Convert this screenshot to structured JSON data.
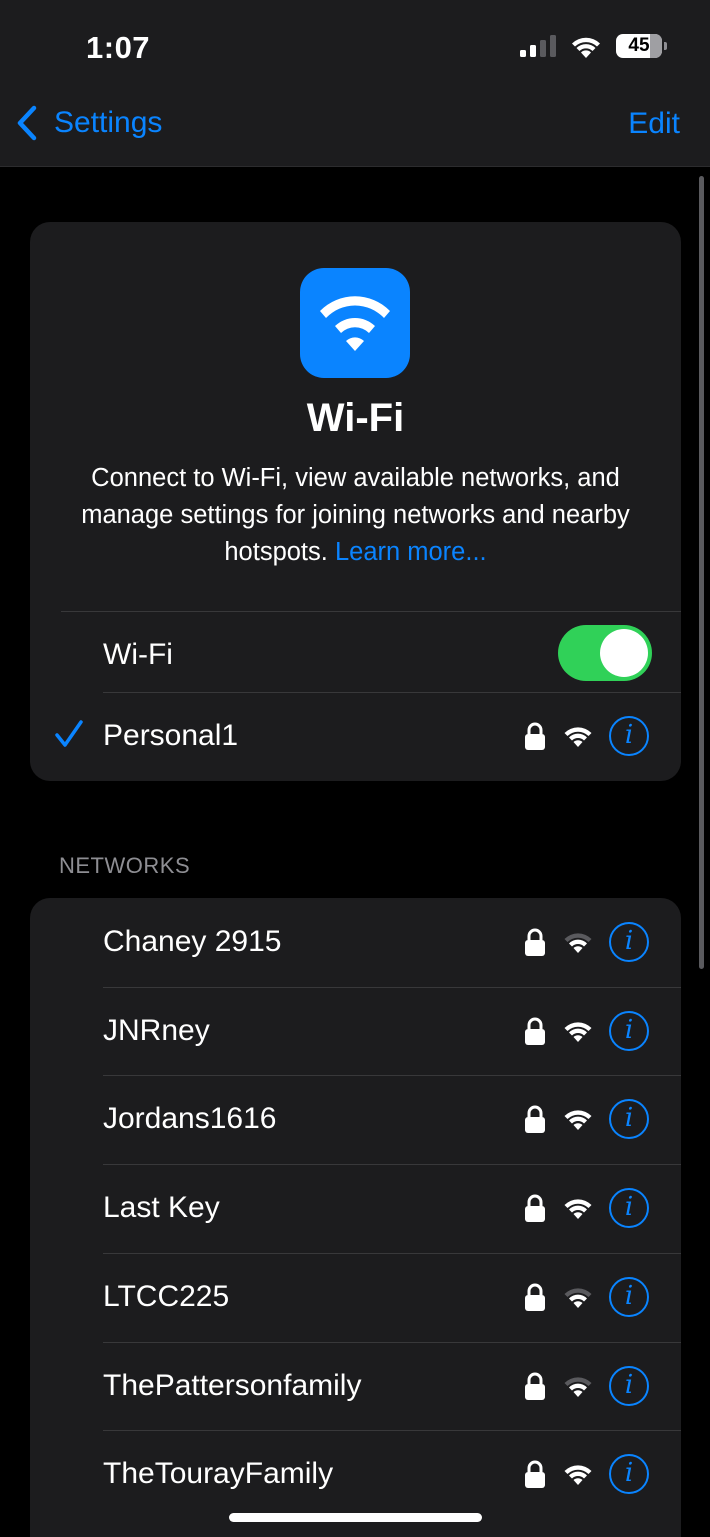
{
  "status_bar": {
    "time": "1:07",
    "battery": "45",
    "cell_signal_icon": "cellular-signal-icon",
    "wifi_icon": "wifi-status-icon"
  },
  "nav": {
    "back_label": "Settings",
    "edit_label": "Edit"
  },
  "header_card": {
    "app_icon": "wifi-app-icon",
    "title": "Wi-Fi",
    "description": "Connect to Wi-Fi, view available networks, and manage settings for joining networks and nearby hotspots.",
    "learn_more": "Learn more..."
  },
  "wifi_toggle": {
    "label": "Wi-Fi",
    "on": true
  },
  "connected_network": {
    "name": "Personal1",
    "secured": true,
    "signal": "full"
  },
  "networks_section": {
    "header": "NETWORKS",
    "items": [
      {
        "name": "Chaney 2915",
        "secured": true,
        "signal": "weak"
      },
      {
        "name": "JNRney",
        "secured": true,
        "signal": "full"
      },
      {
        "name": "Jordans1616",
        "secured": true,
        "signal": "full"
      },
      {
        "name": "Last Key",
        "secured": true,
        "signal": "full"
      },
      {
        "name": "LTCC225",
        "secured": true,
        "signal": "weak"
      },
      {
        "name": "ThePattersonfamily",
        "secured": true,
        "signal": "weak"
      },
      {
        "name": "TheTourayFamily",
        "secured": true,
        "signal": "full"
      }
    ]
  },
  "colors": {
    "accent": "#0a84ff",
    "toggle_on": "#30d158",
    "cell_background": "#1c1c1e",
    "page_background": "#000000"
  }
}
